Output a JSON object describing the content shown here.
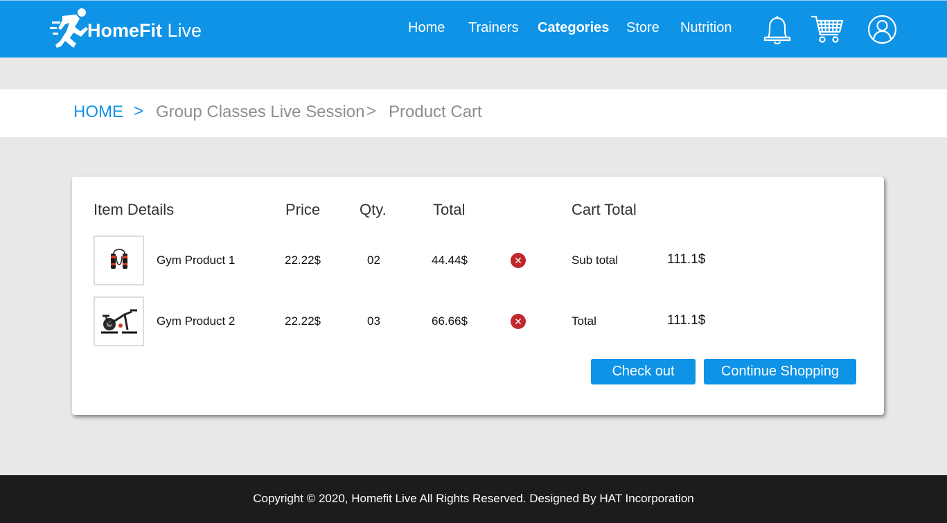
{
  "brand": {
    "name_bold": "HomeFit",
    "name_light": "Live"
  },
  "nav": {
    "items": [
      {
        "label": "Home",
        "active": false
      },
      {
        "label": "Trainers",
        "active": false
      },
      {
        "label": "Categories",
        "active": true
      },
      {
        "label": "Store",
        "active": false
      },
      {
        "label": "Nutrition",
        "active": false
      }
    ],
    "icons": [
      "bell-icon",
      "cart-icon",
      "user-icon"
    ]
  },
  "breadcrumb": {
    "items": [
      "HOME",
      "Group Classes Live Session",
      "Product Cart"
    ],
    "separator": ">"
  },
  "cart": {
    "headers": {
      "item": "Item Details",
      "price": "Price",
      "qty": "Qty.",
      "total": "Total",
      "cart_total": "Cart Total"
    },
    "rows": [
      {
        "name": "Gym Product 1",
        "price": "22.22$",
        "qty": "02",
        "total": "44.44$",
        "image": "jump-rope"
      },
      {
        "name": "Gym Product 2",
        "price": "22.22$",
        "qty": "03",
        "total": "66.66$",
        "image": "exercise-bike"
      }
    ],
    "summary": {
      "subtotal_label": "Sub total",
      "subtotal_value": "111.1$",
      "total_label": "Total",
      "total_value": "111.1$"
    },
    "buttons": {
      "checkout": "Check out",
      "continue": "Continue Shopping"
    }
  },
  "footer": {
    "text": "Copyright © 2020, Homefit Live All Rights Reserved. Designed By HAT Incorporation"
  },
  "colors": {
    "primary": "#0e93e6",
    "remove": "#c1272d",
    "footer": "#1c1c1c",
    "page_bg": "#e8e8e8"
  }
}
